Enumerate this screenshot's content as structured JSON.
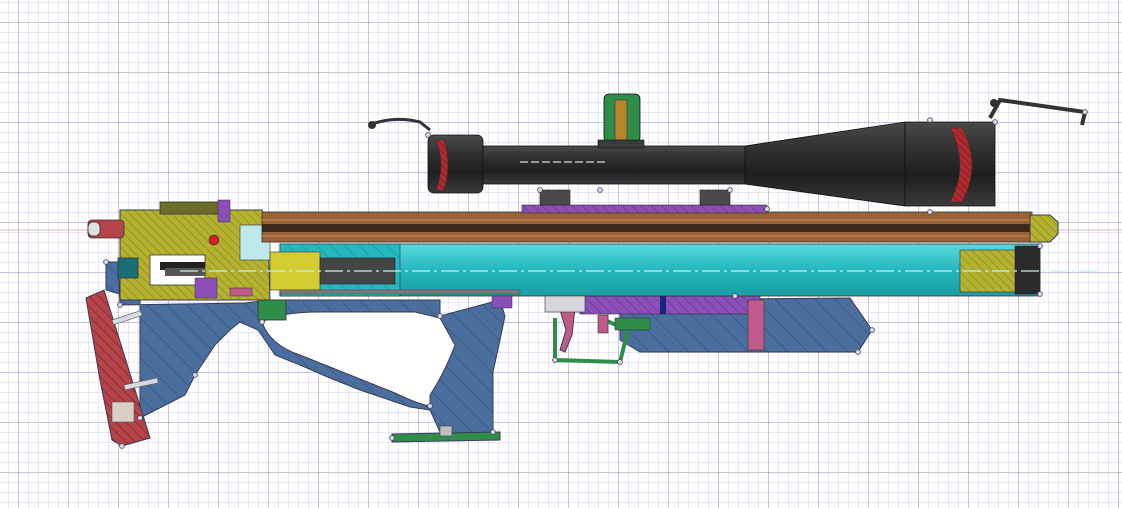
{
  "colors": {
    "stock": "#4a6f9e",
    "stock_dark": "#2f4d78",
    "buttpad": "#b5434a",
    "brass": "#b5b230",
    "brass_light": "#e3dc3a",
    "barrel": "#9a6336",
    "barrel_dark": "#5b3b22",
    "cylinder": "#22b8be",
    "cylinder_light": "#6fe3e7",
    "rail": "#8a4fb8",
    "scope": "#2b2b2b",
    "scope_light": "#5a5a5a",
    "lens": "#b02a30",
    "trigger": "#c05a8a",
    "green_part": "#2f8d4a",
    "axis_line": "#e05a7a",
    "center_line": "#c8f0f2"
  },
  "icons": {
    "background": "cad-grid",
    "assembly": "pcp-air-rifle-cross-section"
  }
}
